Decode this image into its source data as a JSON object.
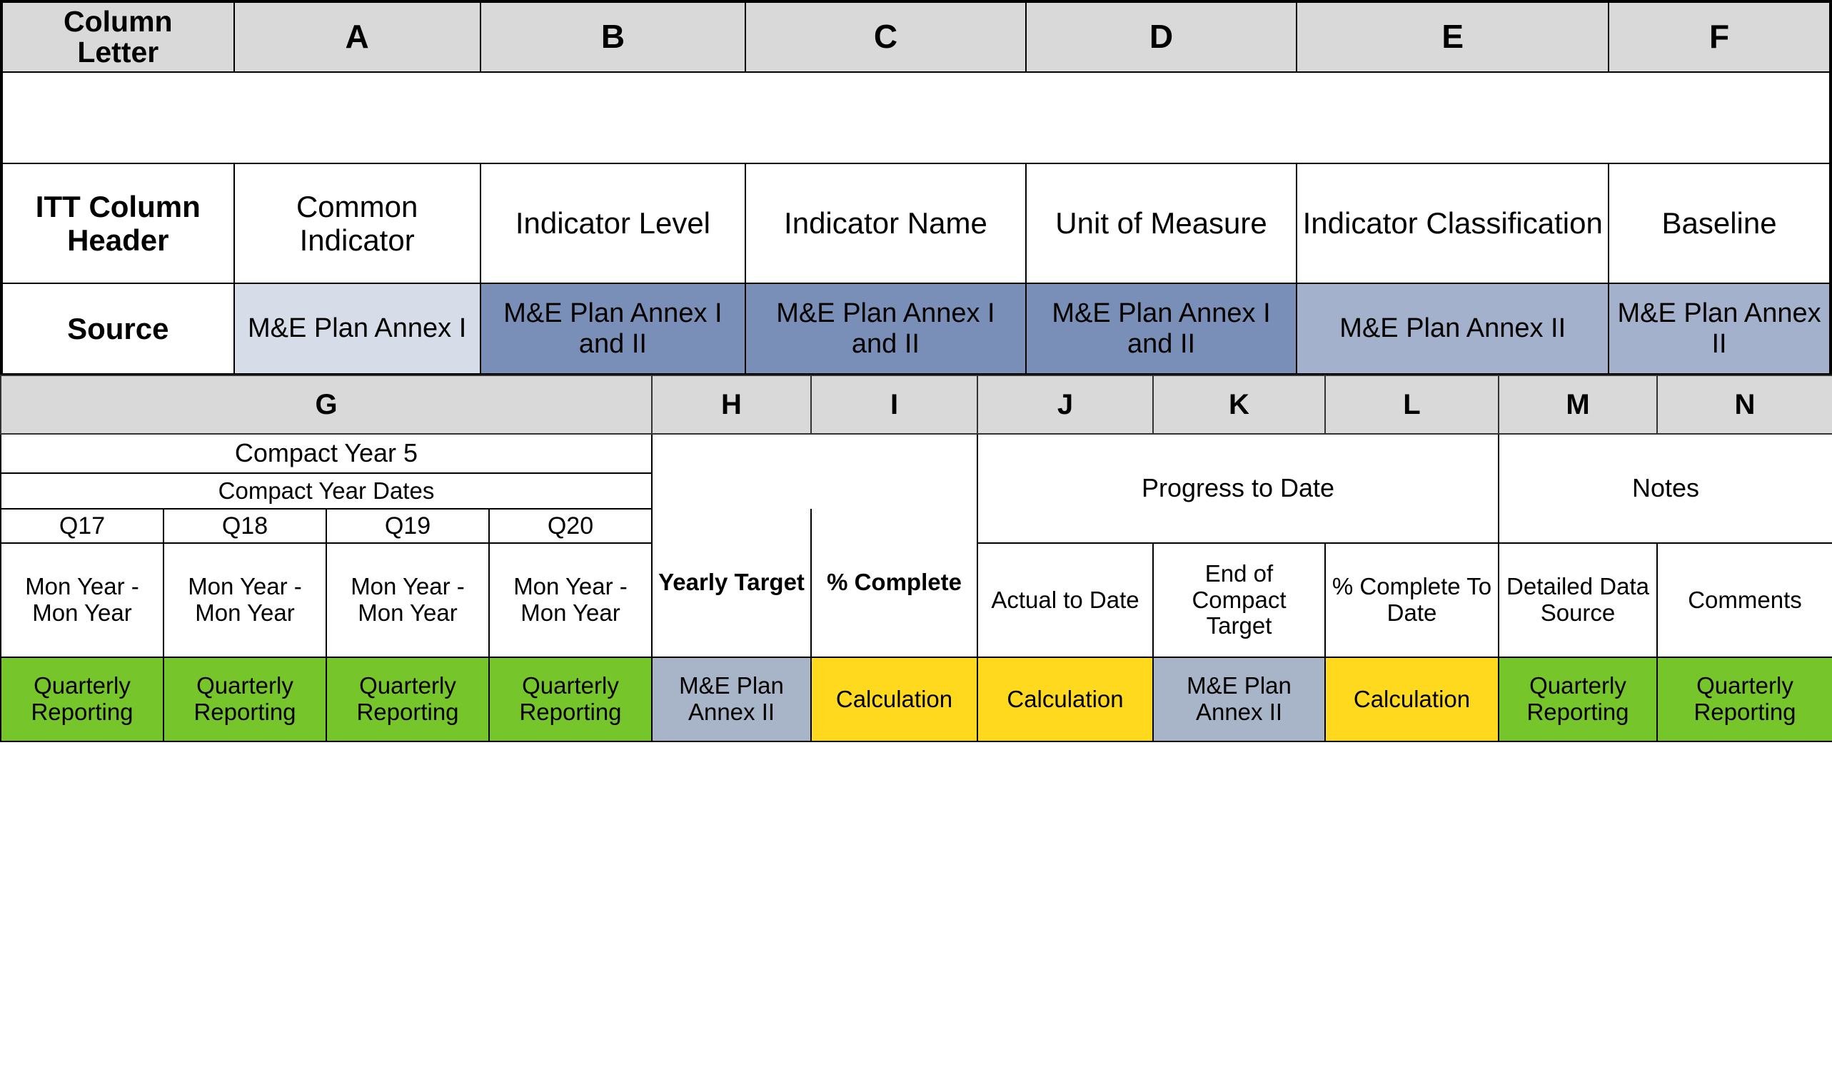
{
  "top_table": {
    "row_labels": {
      "column_letter": "Column\nLetter",
      "column_letter_line1": "Column",
      "column_letter_line2": "Letter",
      "itt_column_header_line1": "ITT Column",
      "itt_column_header_line2": "Header",
      "source": "Source"
    },
    "column_letters": [
      "A",
      "B",
      "C",
      "D",
      "E",
      "F"
    ],
    "itt_column_headers": [
      "Common Indicator",
      "Indicator Level",
      "Indicator Name",
      "Unit of Measure",
      "Indicator Classification",
      "Baseline"
    ],
    "sources": [
      "M&E Plan Annex I",
      "M&E Plan Annex I and II",
      "M&E Plan Annex I and II",
      "M&E Plan Annex I and II",
      "M&E Plan Annex II",
      "M&E Plan Annex II"
    ],
    "source_fills": [
      "#d6dce8",
      "#7a8fb8",
      "#7a8fb8",
      "#7a8fb8",
      "#a3b1cc",
      "#a3b1cc"
    ]
  },
  "bottom_table": {
    "column_letters": [
      "G",
      "H",
      "I",
      "J",
      "K",
      "L",
      "M",
      "N"
    ],
    "groups": {
      "compact_year": "Compact Year 5",
      "compact_year_dates": "Compact Year Dates",
      "progress_to_date": "Progress to Date",
      "notes": "Notes"
    },
    "quarters": [
      "Q17",
      "Q18",
      "Q19",
      "Q20"
    ],
    "quarter_dates": [
      "Mon Year - Mon Year",
      "Mon Year - Mon Year",
      "Mon Year - Mon Year",
      "Mon Year - Mon Year"
    ],
    "detail_headers": [
      "Yearly Target",
      "% Complete",
      "Actual to Date",
      "End of Compact Target",
      "% Complete To Date",
      "Detailed Data Source",
      "Comments"
    ],
    "sources": [
      "Quarterly Reporting",
      "Quarterly Reporting",
      "Quarterly Reporting",
      "Quarterly Reporting",
      "M&E Plan Annex II",
      "Calculation",
      "Calculation",
      "M&E Plan Annex II",
      "Calculation",
      "Quarterly Reporting",
      "Quarterly Reporting"
    ],
    "source_fills": [
      "#76c62b",
      "#76c62b",
      "#76c62b",
      "#76c62b",
      "#a8b4c8",
      "#ffd91e",
      "#ffd91e",
      "#a8b4c8",
      "#ffd91e",
      "#76c62b",
      "#76c62b"
    ]
  },
  "colors": {
    "header_grey": "#d9d9d9",
    "light_blue": "#d6dce8",
    "dark_blue": "#7a8fb8",
    "steel_blue": "#a3b1cc",
    "grey_blue": "#a8b4c8",
    "green": "#76c62b",
    "yellow": "#ffd91e",
    "border": "#000000"
  }
}
